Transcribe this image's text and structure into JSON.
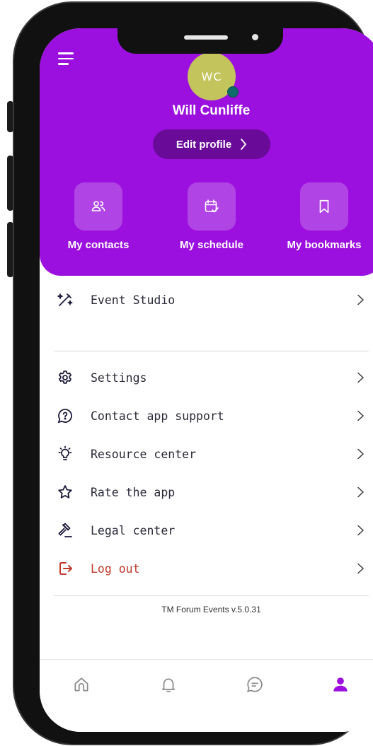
{
  "profile": {
    "initials": "WC",
    "name": "Will Cunliffe",
    "edit_label": "Edit profile"
  },
  "shortcuts": [
    {
      "label": "My contacts",
      "icon": "contacts-icon"
    },
    {
      "label": "My schedule",
      "icon": "calendar-check-icon"
    },
    {
      "label": "My bookmarks",
      "icon": "bookmark-icon"
    }
  ],
  "menu": {
    "items": [
      {
        "label": "Event Studio",
        "icon": "magic-wand-icon"
      },
      {
        "label": "Settings",
        "icon": "gear-icon"
      },
      {
        "label": "Contact app support",
        "icon": "help-chat-icon"
      },
      {
        "label": "Resource center",
        "icon": "lightbulb-icon"
      },
      {
        "label": "Rate the app",
        "icon": "star-icon"
      },
      {
        "label": "Legal center",
        "icon": "gavel-icon"
      },
      {
        "label": "Log out",
        "icon": "logout-icon"
      }
    ]
  },
  "footer": {
    "version": "TM Forum Events v.5.0.31"
  },
  "tabbar": {
    "tabs": [
      "home-icon",
      "bell-icon",
      "chat-icon",
      "profile-icon"
    ]
  },
  "colors": {
    "brand": "#9b10de",
    "logout": "#c0392b",
    "active_tab": "#9b10de"
  }
}
